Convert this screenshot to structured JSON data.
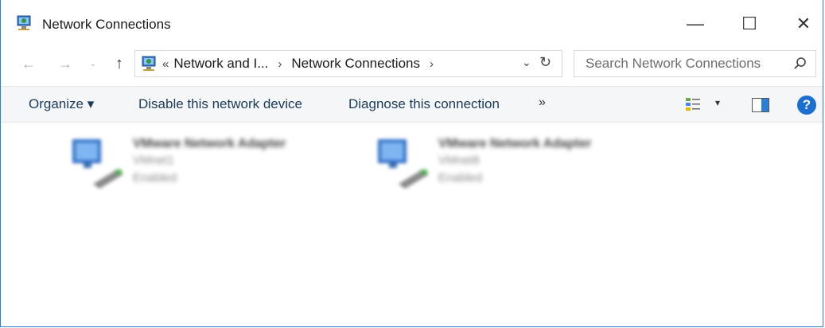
{
  "window": {
    "title": "Network Connections",
    "minimize": "—",
    "maximize": "☐",
    "close": "✕"
  },
  "nav": {
    "back": "←",
    "forward": "→",
    "recent": "⌄",
    "up": "↑"
  },
  "address": {
    "overflow": "«",
    "crumbs": [
      "Network and I...",
      "Network Connections"
    ],
    "separator": "›",
    "dropdown": "⌄",
    "refresh": "↻"
  },
  "search": {
    "placeholder": "Search Network Connections"
  },
  "toolbar": {
    "organize": "Organize ▾",
    "disable": "Disable this network device",
    "diagnose": "Diagnose this connection",
    "more": "»",
    "views_dropdown": "▾",
    "help": "?"
  },
  "adapters": [
    {
      "name": "VMware Network Adapter",
      "id": "VMnet1",
      "status": "Enabled"
    },
    {
      "name": "VMware Network Adapter",
      "id": "VMnet8",
      "status": "Enabled"
    }
  ],
  "colors": {
    "accent": "#2b7fd4",
    "help": "#1a6fd0",
    "commandbar": "#f5f6f7"
  }
}
